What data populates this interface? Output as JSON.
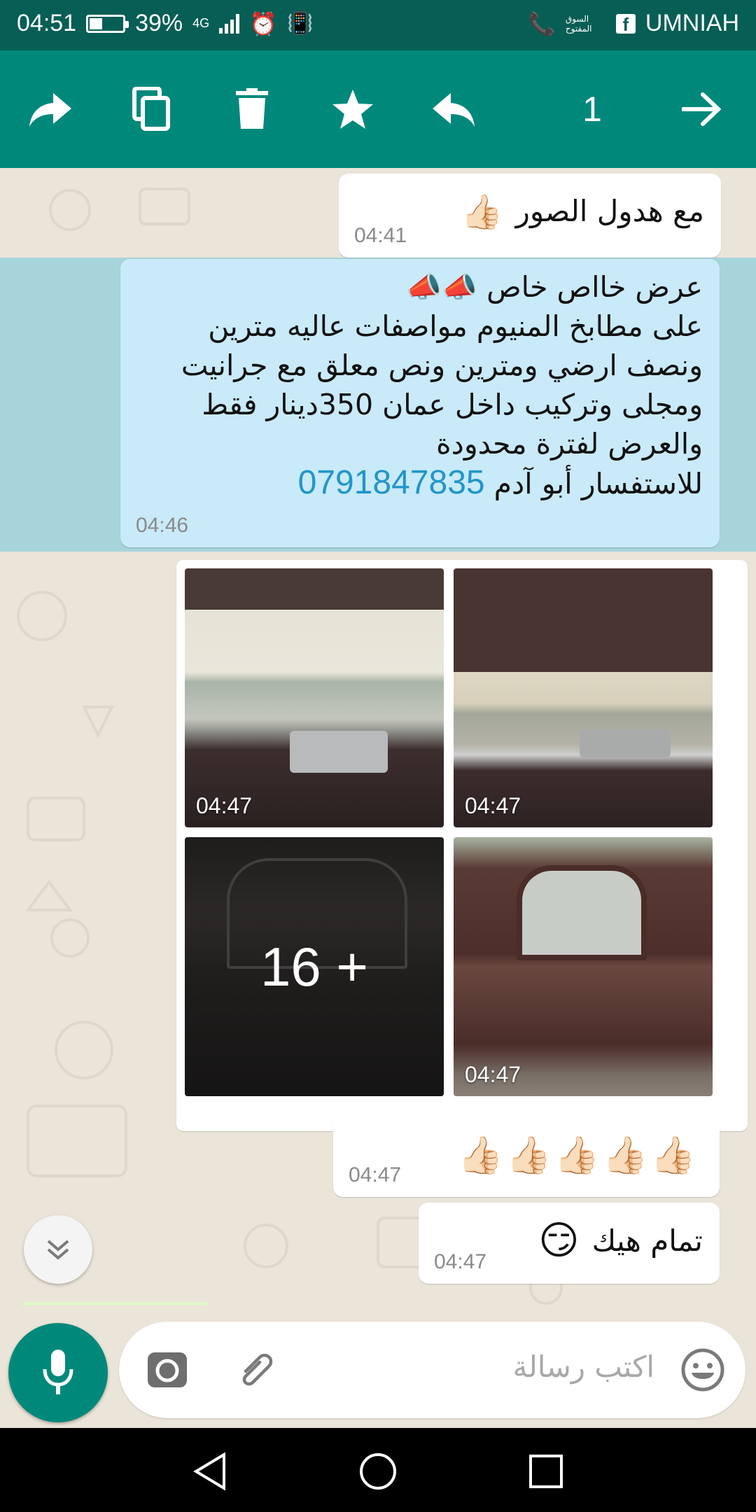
{
  "status_bar": {
    "time": "04:51",
    "battery_percent": "39%",
    "network_type": "4G",
    "carrier": "UMNIAH",
    "app_badge": "السوق المفتوح"
  },
  "action_bar": {
    "selected_count": "1",
    "icons": [
      "forward-icon",
      "copy-icon",
      "delete-icon",
      "star-icon",
      "reply-icon",
      "arrow-right-icon"
    ]
  },
  "messages": [
    {
      "text": "مع هدول الصور",
      "emoji": "👍🏻",
      "time": "04:41"
    },
    {
      "lines": [
        "عرض خااص خاص 📣📣",
        "على مطابخ المنيوم مواصفات عاليه مترين",
        "ونصف ارضي ومترين ونص معلق مع جرانيت",
        "ومجلى وتركيب داخل عمان 350دينار فقط",
        "والعرض لفترة محدودة"
      ],
      "inquiry_text": "للاستفسار أبو آدم",
      "phone": "0791847835",
      "time": "04:46",
      "selected": true
    },
    {
      "photos": [
        {
          "time": "04:47"
        },
        {
          "time": "04:47"
        },
        {
          "more_count": "+ 16"
        },
        {
          "time": "04:47"
        }
      ]
    },
    {
      "emoji": "👍🏻👍🏻👍🏻👍🏻👍🏻",
      "time": "04:47"
    },
    {
      "text": "تمام هيك",
      "emoji": "😏",
      "time": "04:47"
    }
  ],
  "input": {
    "placeholder": "اكتب رسالة"
  },
  "colors": {
    "header": "#00897b",
    "status": "#075e54",
    "selected_row": "#70c6de",
    "link": "#2196c9"
  }
}
